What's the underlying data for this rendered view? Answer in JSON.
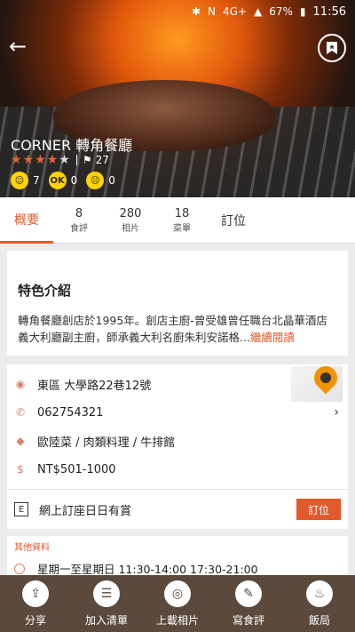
{
  "status_bar": {
    "battery": "67%",
    "time": "11:56",
    "network": "4G+"
  },
  "header": {
    "title": "CORNER 轉角餐廳",
    "rating_stars": 4,
    "bookmark_count": "27",
    "reactions": [
      {
        "icon": "smile-face-icon",
        "count": "7"
      },
      {
        "icon": "ok-face-icon",
        "label": "OK",
        "count": "0"
      },
      {
        "icon": "sad-face-icon",
        "count": "0"
      }
    ]
  },
  "tabs": [
    {
      "label": "概要"
    },
    {
      "count": "8",
      "label": "食評"
    },
    {
      "count": "280",
      "label": "相片"
    },
    {
      "count": "18",
      "label": "菜單"
    },
    {
      "label": "訂位"
    }
  ],
  "intro": {
    "title": "特色介紹",
    "body": "轉角餐廳創店於1995年。創店主廚-曾受雄曾任職台北晶華酒店義大利廳副主廚，師承義大利名廚朱利安諾格...",
    "read_more": "繼續閱讀"
  },
  "info": {
    "address": "東區 大學路22巷12號",
    "phone": "062754321",
    "cuisine": "歐陸菜 / 肉類料理 / 牛排館",
    "price": "NT$501-1000",
    "reserve_text": "網上訂座日日有賞",
    "reserve_button": "訂位"
  },
  "other": {
    "title": "其他資料",
    "hours": "星期一至星期日 11:30-14:00 17:30-21:00"
  },
  "bottom_bar": [
    {
      "icon": "share-icon",
      "label": "分享"
    },
    {
      "icon": "add-list-icon",
      "label": "加入清單"
    },
    {
      "icon": "camera-icon",
      "label": "上載相片"
    },
    {
      "icon": "write-review-icon",
      "label": "寫食評"
    },
    {
      "icon": "restaurant-icon",
      "label": "飯局"
    }
  ]
}
